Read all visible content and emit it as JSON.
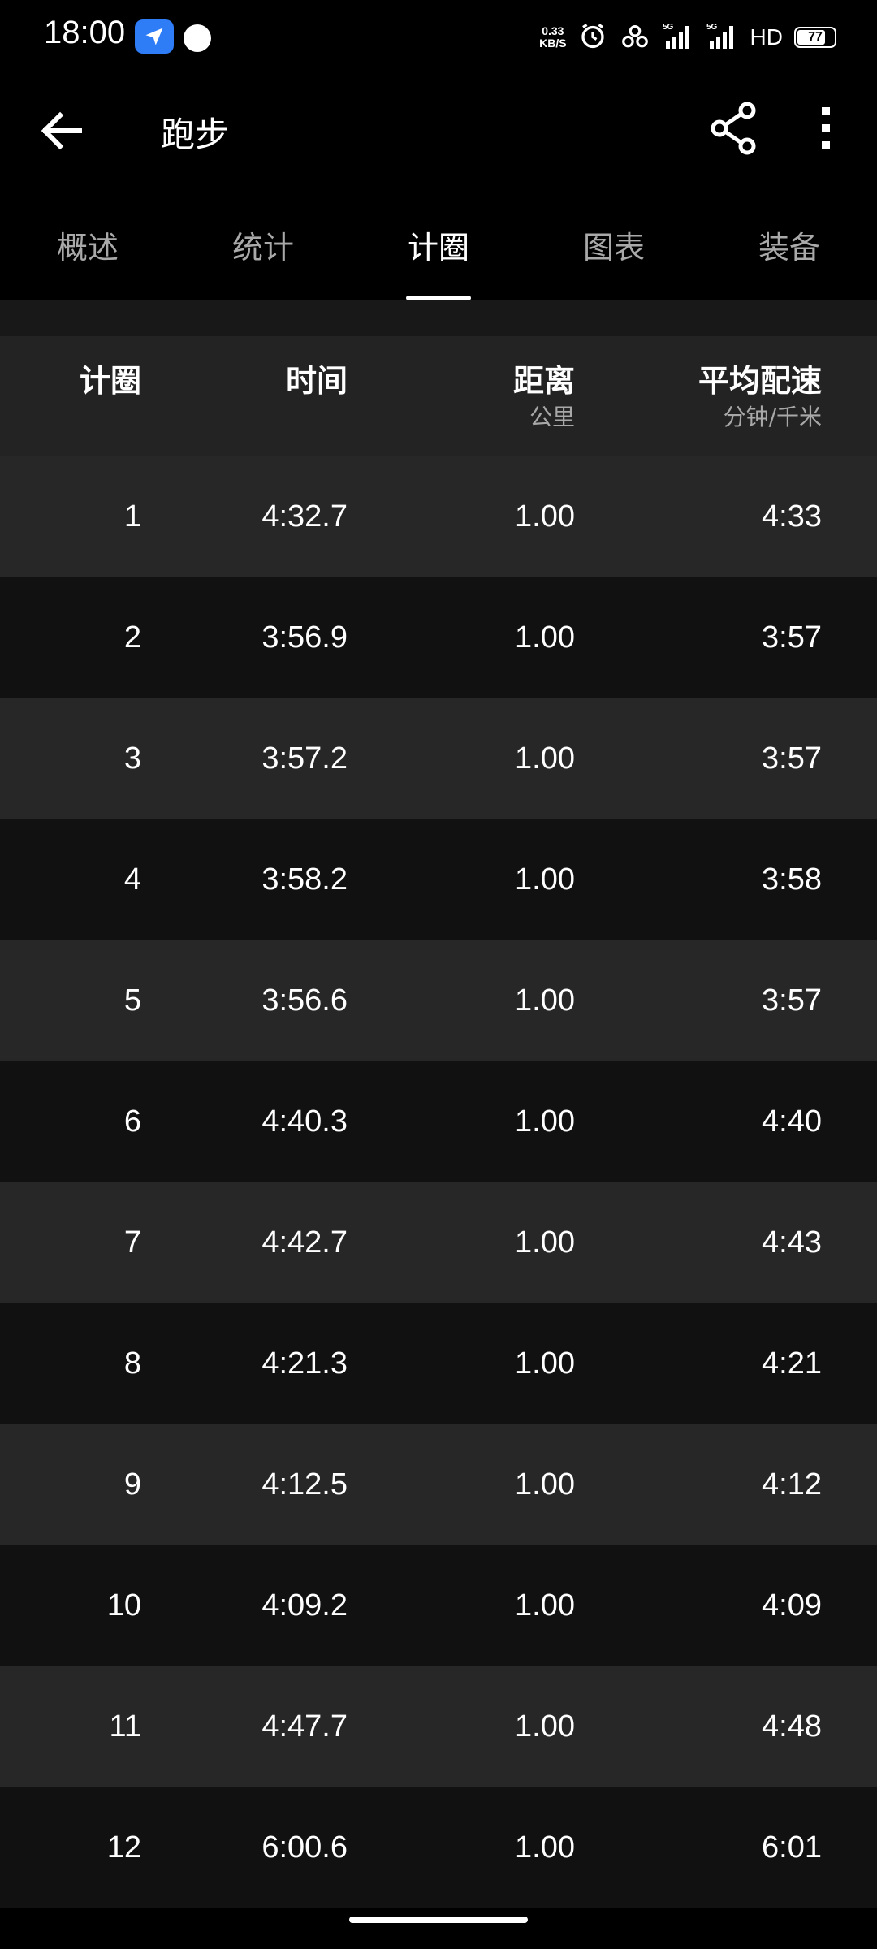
{
  "status_bar": {
    "time": "18:00",
    "net_speed_value": "0.33",
    "net_speed_unit": "KB/S",
    "network_1": "5G",
    "network_2": "5G",
    "hd_label": "HD",
    "battery_level": "77",
    "battery_fraction": 0.77
  },
  "app_bar": {
    "title": "跑步",
    "back_icon": "arrow-left-icon",
    "share_icon": "share-icon",
    "more_icon": "more-vertical-icon"
  },
  "tabs": [
    {
      "label": "概述",
      "active": false
    },
    {
      "label": "统计",
      "active": false
    },
    {
      "label": "计圈",
      "active": true
    },
    {
      "label": "图表",
      "active": false
    },
    {
      "label": "装备",
      "active": false
    }
  ],
  "table": {
    "headers": {
      "lap": "计圈",
      "time": "时间",
      "distance": "距离",
      "distance_unit": "公里",
      "pace": "平均配速",
      "pace_unit": "分钟/千米"
    },
    "rows": [
      {
        "lap": "1",
        "time": "4:32.7",
        "distance": "1.00",
        "pace": "4:33"
      },
      {
        "lap": "2",
        "time": "3:56.9",
        "distance": "1.00",
        "pace": "3:57"
      },
      {
        "lap": "3",
        "time": "3:57.2",
        "distance": "1.00",
        "pace": "3:57"
      },
      {
        "lap": "4",
        "time": "3:58.2",
        "distance": "1.00",
        "pace": "3:58"
      },
      {
        "lap": "5",
        "time": "3:56.6",
        "distance": "1.00",
        "pace": "3:57"
      },
      {
        "lap": "6",
        "time": "4:40.3",
        "distance": "1.00",
        "pace": "4:40"
      },
      {
        "lap": "7",
        "time": "4:42.7",
        "distance": "1.00",
        "pace": "4:43"
      },
      {
        "lap": "8",
        "time": "4:21.3",
        "distance": "1.00",
        "pace": "4:21"
      },
      {
        "lap": "9",
        "time": "4:12.5",
        "distance": "1.00",
        "pace": "4:12"
      },
      {
        "lap": "10",
        "time": "4:09.2",
        "distance": "1.00",
        "pace": "4:09"
      },
      {
        "lap": "11",
        "time": "4:47.7",
        "distance": "1.00",
        "pace": "4:48"
      },
      {
        "lap": "12",
        "time": "6:00.6",
        "distance": "1.00",
        "pace": "6:01"
      }
    ]
  },
  "colors": {
    "background": "#000000",
    "row_light": "#272727",
    "row_dark": "#111111",
    "header_bg": "#232323",
    "nav_badge": "#2f7df6",
    "tab_inactive": "#a9a9a9"
  }
}
